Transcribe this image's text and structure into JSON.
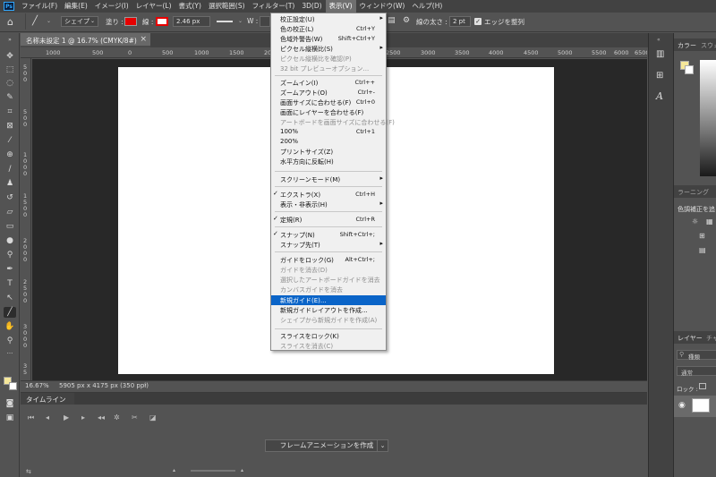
{
  "menubar": {
    "items": [
      {
        "label": "ファイル(F)"
      },
      {
        "label": "編集(E)"
      },
      {
        "label": "イメージ(I)"
      },
      {
        "label": "レイヤー(L)"
      },
      {
        "label": "書式(Y)"
      },
      {
        "label": "選択範囲(S)"
      },
      {
        "label": "フィルター(T)"
      },
      {
        "label": "3D(D)"
      },
      {
        "label": "表示(V)"
      },
      {
        "label": "ウィンドウ(W)"
      },
      {
        "label": "ヘルプ(H)"
      }
    ]
  },
  "options": {
    "shape_mode": "シェイプ",
    "fill_label": "塗り :",
    "stroke_label": "線 :",
    "stroke_width": "2.46 px",
    "w_label": "W :",
    "line_weight_label": "線の太さ :",
    "line_weight_value": "2 pt",
    "align_edges": "エッジを整列"
  },
  "document": {
    "tab_title": "名称未設定 1 @ 16.7% (CMYK/8#)",
    "zoom": "16.67%",
    "info": "5905 px x 4175 px (350 ppi)"
  },
  "ruler": {
    "top": [
      "1000",
      "500",
      "0",
      "500",
      "1000",
      "1500",
      "2000",
      "2500",
      "3000",
      "3500",
      "4000",
      "4500",
      "5000",
      "5500",
      "6000",
      "6500"
    ],
    "left": [
      "5",
      "0",
      "0",
      "5",
      "0",
      "0",
      "1",
      "0",
      "0",
      "0",
      "1",
      "5",
      "0",
      "0",
      "2",
      "0",
      "0",
      "0",
      "2",
      "5",
      "0",
      "0",
      "3",
      "0",
      "0",
      "0",
      "3",
      "5"
    ]
  },
  "timeline": {
    "tab": "タイムライン",
    "create_button": "フレームアニメーションを作成"
  },
  "right_panel": {
    "color_tab": "カラー",
    "swatch_tab": "スウォッチ",
    "learn_tab": "ラーニング",
    "adjust_tab": "色調補正を追",
    "layers_tab": "レイヤー",
    "channels_tab": "チャ",
    "kind_label": "種類",
    "blend_mode": "通常",
    "lock_label": "ロック :"
  },
  "view_menu": {
    "items": [
      {
        "label": "校正設定(U)",
        "shortcut": "",
        "arrow": true
      },
      {
        "label": "色の校正(L)",
        "shortcut": "Ctrl+Y"
      },
      {
        "label": "色域外警告(W)",
        "shortcut": "Shift+Ctrl+Y"
      },
      {
        "label": "ピクセル縦横比(S)",
        "shortcut": "",
        "arrow": true
      },
      {
        "label": "ピクセル縦横比を確認(P)",
        "shortcut": "",
        "disabled": true
      },
      {
        "label": "32 bit プレビューオプション...",
        "shortcut": "",
        "disabled": true
      },
      {
        "label": "ズームイン(I)",
        "shortcut": "Ctrl++"
      },
      {
        "label": "ズームアウト(O)",
        "shortcut": "Ctrl+-"
      },
      {
        "label": "画面サイズに合わせる(F)",
        "shortcut": "Ctrl+0"
      },
      {
        "label": "画面にレイヤーを合わせる(F)",
        "shortcut": ""
      },
      {
        "label": "アートボードを画面サイズに合わせる(F)",
        "shortcut": "",
        "disabled": true
      },
      {
        "label": "100%",
        "shortcut": "Ctrl+1"
      },
      {
        "label": "200%",
        "shortcut": ""
      },
      {
        "label": "プリントサイズ(Z)",
        "shortcut": ""
      },
      {
        "label": "水平方向に反転(H)",
        "shortcut": ""
      },
      {
        "label": "スクリーンモード(M)",
        "shortcut": "",
        "arrow": true
      },
      {
        "label": "エクストラ(X)",
        "shortcut": "Ctrl+H",
        "checked": true
      },
      {
        "label": "表示・非表示(H)",
        "shortcut": "",
        "arrow": true
      },
      {
        "label": "定規(R)",
        "shortcut": "Ctrl+R",
        "checked": true
      },
      {
        "label": "スナップ(N)",
        "shortcut": "Shift+Ctrl+;",
        "checked": true
      },
      {
        "label": "スナップ先(T)",
        "shortcut": "",
        "arrow": true
      },
      {
        "label": "ガイドをロック(G)",
        "shortcut": "Alt+Ctrl+;"
      },
      {
        "label": "ガイドを消去(D)",
        "shortcut": "",
        "disabled": true
      },
      {
        "label": "選択したアートボードガイドを消去",
        "shortcut": "",
        "disabled": true
      },
      {
        "label": "カンバスガイドを消去",
        "shortcut": "",
        "disabled": true
      },
      {
        "label": "新規ガイド(E)...",
        "shortcut": "",
        "highlighted": true
      },
      {
        "label": "新規ガイドレイアウトを作成...",
        "shortcut": ""
      },
      {
        "label": "シェイプから新規ガイドを作成(A)",
        "shortcut": "",
        "disabled": true
      },
      {
        "label": "スライスをロック(K)",
        "shortcut": ""
      },
      {
        "label": "スライスを消去(C)",
        "shortcut": "",
        "disabled": true
      }
    ]
  }
}
